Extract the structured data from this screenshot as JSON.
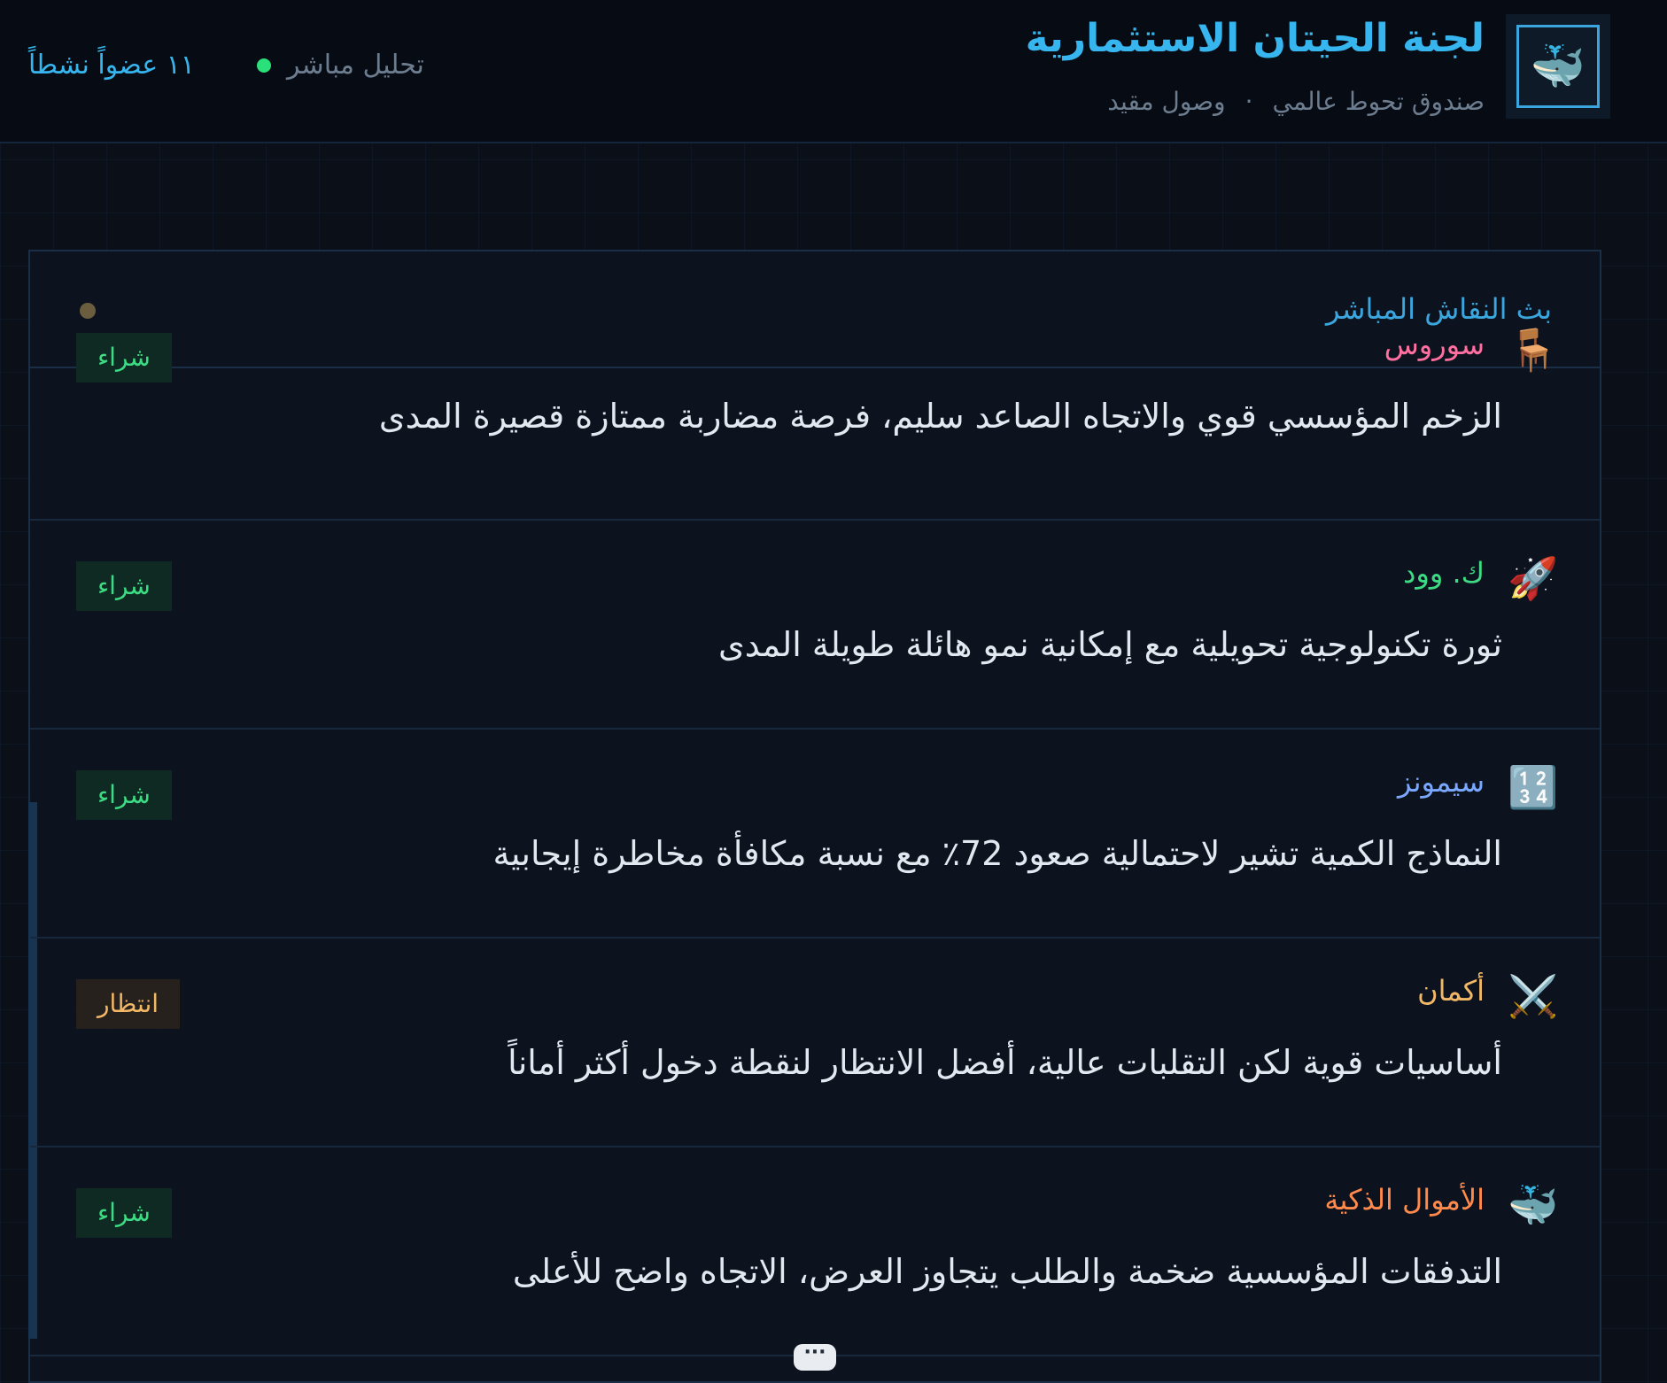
{
  "header": {
    "title": "لجنة  الحيتان  الاستثمارية",
    "subtitle_part1": "صندوق  تحوط  عالمي",
    "subtitle_sep": "·",
    "subtitle_part2": "وصول  مقيد",
    "live_label": "تحليل  مباشر",
    "members_label": "١١  عضواً  نشطاً",
    "logo_icon": "whale-icon"
  },
  "panel": {
    "title": "بث  النقاش  المباشر"
  },
  "messages": [
    {
      "icon": "🪑",
      "icon_name": "chess-pawn-icon",
      "name": "سوروس",
      "name_color": "#ff6fa0",
      "text": "الزخم المؤسسي قوي والاتجاه الصاعد سليم، فرصة مضاربة ممتازة قصيرة المدى",
      "badge": "شراء",
      "badge_type": "buy"
    },
    {
      "icon": "🚀",
      "icon_name": "rocket-icon",
      "name": "ك.  وود",
      "name_color": "#3ddc84",
      "text": "ثورة تكنولوجية تحويلية مع إمكانية نمو هائلة طويلة المدى",
      "badge": "شراء",
      "badge_type": "buy"
    },
    {
      "icon": "🔢",
      "icon_name": "numbers-icon",
      "name": "سيمونز",
      "name_color": "#7aa8ff",
      "text": "النماذج الكمية تشير لاحتمالية صعود 72٪ مع نسبة مكافأة مخاطرة إيجابية",
      "badge": "شراء",
      "badge_type": "buy"
    },
    {
      "icon": "⚔️",
      "icon_name": "crossed-swords-icon",
      "name": "أكمان",
      "name_color": "#f2b866",
      "text": "أساسيات قوية لكن التقلبات عالية، أفضل الانتظار لنقطة دخول أكثر أماناً",
      "badge": "انتظار",
      "badge_type": "wait"
    },
    {
      "icon": "🐳",
      "icon_name": "whale-icon",
      "name": "الأموال  الذكية",
      "name_color": "#ff8a4c",
      "text": "التدفقات المؤسسية ضخمة والطلب يتجاوز العرض، الاتجاه واضح للأعلى",
      "badge": "شراء",
      "badge_type": "buy"
    }
  ],
  "pill_label": "···"
}
